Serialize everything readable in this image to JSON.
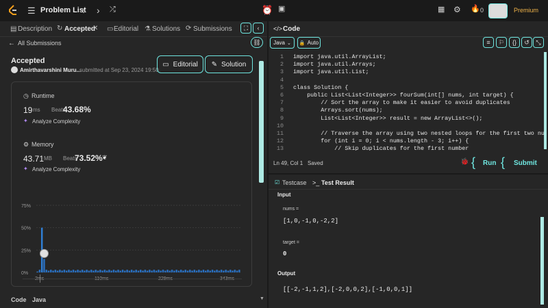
{
  "topbar": {
    "title": "Problem List",
    "fire_count": "0",
    "premium": "Premium"
  },
  "left_tabs": [
    "Description",
    "Accepted",
    "Editorial",
    "Solutions",
    "Submissions"
  ],
  "all_submissions": "All Submissions",
  "submission": {
    "status": "Accepted",
    "user": "Amirthavarshini Muru...",
    "submitted_at": "submitted at Sep 23, 2024 19:50",
    "editorial_btn": "Editorial",
    "solution_btn": "Solution"
  },
  "runtime": {
    "label": "Runtime",
    "value": "19",
    "unit": "ms",
    "beats_label": "Beats",
    "beats": "43.68%",
    "analyze": "Analyze Complexity"
  },
  "memory": {
    "label": "Memory",
    "value": "43.71",
    "unit": "MB",
    "beats_label": "Beats",
    "beats": "73.52%",
    "analyze": "Analyze Complexity"
  },
  "chart_data": {
    "type": "bar",
    "yticks": [
      "75%",
      "50%",
      "25%",
      "0%"
    ],
    "xticks": [
      "2ms",
      "110ms",
      "229ms",
      "343ms"
    ],
    "ylim": [
      0,
      75
    ],
    "values": [
      1,
      3,
      50,
      15,
      3,
      2,
      3,
      2,
      3,
      2,
      3,
      2,
      3,
      2,
      3,
      2,
      3,
      2,
      3,
      2,
      3,
      2,
      3,
      2,
      3,
      2,
      3,
      2,
      3,
      2,
      3,
      2,
      3,
      2,
      3,
      2,
      3,
      2,
      3,
      2,
      3,
      2,
      3,
      2,
      3,
      2,
      3,
      2,
      3,
      2,
      3,
      2,
      3,
      2,
      3,
      2,
      3,
      2,
      3,
      2,
      3,
      2,
      3,
      2,
      3,
      2,
      3,
      2,
      3,
      2,
      3,
      2,
      3,
      2,
      3,
      2,
      3,
      2,
      3,
      2,
      3,
      2,
      3,
      2,
      3,
      2,
      3,
      2,
      3,
      2,
      3
    ]
  },
  "code_footer": {
    "label": "Code",
    "lang": "Java"
  },
  "code_panel": {
    "title": "Code",
    "lang": "Java",
    "auto": "Auto",
    "status": "Ln 49, Col 1",
    "saved": "Saved",
    "run": "Run",
    "submit": "Submit"
  },
  "code_lines": [
    {
      "n": "1",
      "t": "import java.util.ArrayList;"
    },
    {
      "n": "2",
      "t": "import java.util.Arrays;"
    },
    {
      "n": "3",
      "t": "import java.util.List;"
    },
    {
      "n": "4",
      "t": ""
    },
    {
      "n": "5",
      "t": "class Solution {"
    },
    {
      "n": "6",
      "t": "    public List<List<Integer>> fourSum(int[] nums, int target) {"
    },
    {
      "n": "7",
      "t": "        // Sort the array to make it easier to avoid duplicates"
    },
    {
      "n": "8",
      "t": "        Arrays.sort(nums);"
    },
    {
      "n": "9",
      "t": "        List<List<Integer>> result = new ArrayList<>();"
    },
    {
      "n": "10",
      "t": ""
    },
    {
      "n": "11",
      "t": "        // Traverse the array using two nested loops for the first two numbers"
    },
    {
      "n": "12",
      "t": "        for (int i = 0; i < nums.length - 3; i++) {"
    },
    {
      "n": "13",
      "t": "            // Skip duplicates for the first number"
    }
  ],
  "testcase": {
    "tab1": "Testcase",
    "tab2": "Test Result",
    "input_label": "Input",
    "nums_label": "nums =",
    "nums_value": "[1,0,-1,0,-2,2]",
    "target_label": "target =",
    "target_value": "0",
    "output_label": "Output",
    "output_value": "[[-2,-1,1,2],[-2,0,0,2],[-1,0,0,1]]"
  }
}
